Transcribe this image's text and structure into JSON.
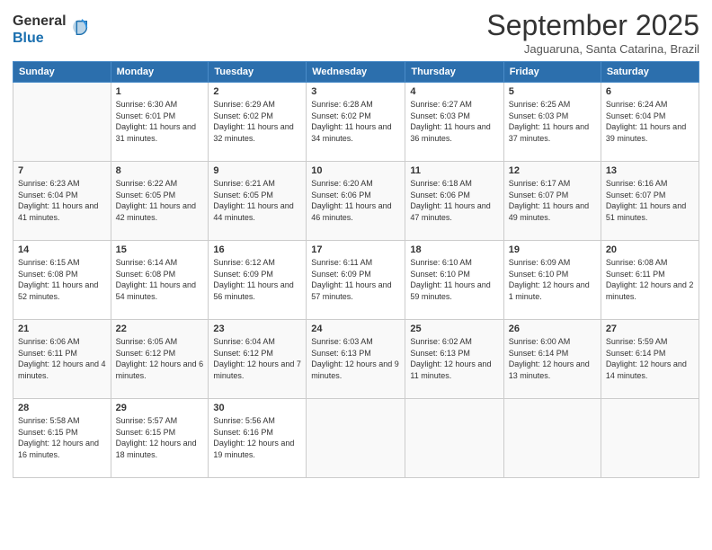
{
  "header": {
    "logo": {
      "line1": "General",
      "line2": "Blue"
    },
    "title": "September 2025",
    "subtitle": "Jaguaruna, Santa Catarina, Brazil"
  },
  "weekdays": [
    "Sunday",
    "Monday",
    "Tuesday",
    "Wednesday",
    "Thursday",
    "Friday",
    "Saturday"
  ],
  "weeks": [
    [
      {
        "day": "",
        "sunrise": "",
        "sunset": "",
        "daylight": ""
      },
      {
        "day": "1",
        "sunrise": "Sunrise: 6:30 AM",
        "sunset": "Sunset: 6:01 PM",
        "daylight": "Daylight: 11 hours and 31 minutes."
      },
      {
        "day": "2",
        "sunrise": "Sunrise: 6:29 AM",
        "sunset": "Sunset: 6:02 PM",
        "daylight": "Daylight: 11 hours and 32 minutes."
      },
      {
        "day": "3",
        "sunrise": "Sunrise: 6:28 AM",
        "sunset": "Sunset: 6:02 PM",
        "daylight": "Daylight: 11 hours and 34 minutes."
      },
      {
        "day": "4",
        "sunrise": "Sunrise: 6:27 AM",
        "sunset": "Sunset: 6:03 PM",
        "daylight": "Daylight: 11 hours and 36 minutes."
      },
      {
        "day": "5",
        "sunrise": "Sunrise: 6:25 AM",
        "sunset": "Sunset: 6:03 PM",
        "daylight": "Daylight: 11 hours and 37 minutes."
      },
      {
        "day": "6",
        "sunrise": "Sunrise: 6:24 AM",
        "sunset": "Sunset: 6:04 PM",
        "daylight": "Daylight: 11 hours and 39 minutes."
      }
    ],
    [
      {
        "day": "7",
        "sunrise": "Sunrise: 6:23 AM",
        "sunset": "Sunset: 6:04 PM",
        "daylight": "Daylight: 11 hours and 41 minutes."
      },
      {
        "day": "8",
        "sunrise": "Sunrise: 6:22 AM",
        "sunset": "Sunset: 6:05 PM",
        "daylight": "Daylight: 11 hours and 42 minutes."
      },
      {
        "day": "9",
        "sunrise": "Sunrise: 6:21 AM",
        "sunset": "Sunset: 6:05 PM",
        "daylight": "Daylight: 11 hours and 44 minutes."
      },
      {
        "day": "10",
        "sunrise": "Sunrise: 6:20 AM",
        "sunset": "Sunset: 6:06 PM",
        "daylight": "Daylight: 11 hours and 46 minutes."
      },
      {
        "day": "11",
        "sunrise": "Sunrise: 6:18 AM",
        "sunset": "Sunset: 6:06 PM",
        "daylight": "Daylight: 11 hours and 47 minutes."
      },
      {
        "day": "12",
        "sunrise": "Sunrise: 6:17 AM",
        "sunset": "Sunset: 6:07 PM",
        "daylight": "Daylight: 11 hours and 49 minutes."
      },
      {
        "day": "13",
        "sunrise": "Sunrise: 6:16 AM",
        "sunset": "Sunset: 6:07 PM",
        "daylight": "Daylight: 11 hours and 51 minutes."
      }
    ],
    [
      {
        "day": "14",
        "sunrise": "Sunrise: 6:15 AM",
        "sunset": "Sunset: 6:08 PM",
        "daylight": "Daylight: 11 hours and 52 minutes."
      },
      {
        "day": "15",
        "sunrise": "Sunrise: 6:14 AM",
        "sunset": "Sunset: 6:08 PM",
        "daylight": "Daylight: 11 hours and 54 minutes."
      },
      {
        "day": "16",
        "sunrise": "Sunrise: 6:12 AM",
        "sunset": "Sunset: 6:09 PM",
        "daylight": "Daylight: 11 hours and 56 minutes."
      },
      {
        "day": "17",
        "sunrise": "Sunrise: 6:11 AM",
        "sunset": "Sunset: 6:09 PM",
        "daylight": "Daylight: 11 hours and 57 minutes."
      },
      {
        "day": "18",
        "sunrise": "Sunrise: 6:10 AM",
        "sunset": "Sunset: 6:10 PM",
        "daylight": "Daylight: 11 hours and 59 minutes."
      },
      {
        "day": "19",
        "sunrise": "Sunrise: 6:09 AM",
        "sunset": "Sunset: 6:10 PM",
        "daylight": "Daylight: 12 hours and 1 minute."
      },
      {
        "day": "20",
        "sunrise": "Sunrise: 6:08 AM",
        "sunset": "Sunset: 6:11 PM",
        "daylight": "Daylight: 12 hours and 2 minutes."
      }
    ],
    [
      {
        "day": "21",
        "sunrise": "Sunrise: 6:06 AM",
        "sunset": "Sunset: 6:11 PM",
        "daylight": "Daylight: 12 hours and 4 minutes."
      },
      {
        "day": "22",
        "sunrise": "Sunrise: 6:05 AM",
        "sunset": "Sunset: 6:12 PM",
        "daylight": "Daylight: 12 hours and 6 minutes."
      },
      {
        "day": "23",
        "sunrise": "Sunrise: 6:04 AM",
        "sunset": "Sunset: 6:12 PM",
        "daylight": "Daylight: 12 hours and 7 minutes."
      },
      {
        "day": "24",
        "sunrise": "Sunrise: 6:03 AM",
        "sunset": "Sunset: 6:13 PM",
        "daylight": "Daylight: 12 hours and 9 minutes."
      },
      {
        "day": "25",
        "sunrise": "Sunrise: 6:02 AM",
        "sunset": "Sunset: 6:13 PM",
        "daylight": "Daylight: 12 hours and 11 minutes."
      },
      {
        "day": "26",
        "sunrise": "Sunrise: 6:00 AM",
        "sunset": "Sunset: 6:14 PM",
        "daylight": "Daylight: 12 hours and 13 minutes."
      },
      {
        "day": "27",
        "sunrise": "Sunrise: 5:59 AM",
        "sunset": "Sunset: 6:14 PM",
        "daylight": "Daylight: 12 hours and 14 minutes."
      }
    ],
    [
      {
        "day": "28",
        "sunrise": "Sunrise: 5:58 AM",
        "sunset": "Sunset: 6:15 PM",
        "daylight": "Daylight: 12 hours and 16 minutes."
      },
      {
        "day": "29",
        "sunrise": "Sunrise: 5:57 AM",
        "sunset": "Sunset: 6:15 PM",
        "daylight": "Daylight: 12 hours and 18 minutes."
      },
      {
        "day": "30",
        "sunrise": "Sunrise: 5:56 AM",
        "sunset": "Sunset: 6:16 PM",
        "daylight": "Daylight: 12 hours and 19 minutes."
      },
      {
        "day": "",
        "sunrise": "",
        "sunset": "",
        "daylight": ""
      },
      {
        "day": "",
        "sunrise": "",
        "sunset": "",
        "daylight": ""
      },
      {
        "day": "",
        "sunrise": "",
        "sunset": "",
        "daylight": ""
      },
      {
        "day": "",
        "sunrise": "",
        "sunset": "",
        "daylight": ""
      }
    ]
  ]
}
